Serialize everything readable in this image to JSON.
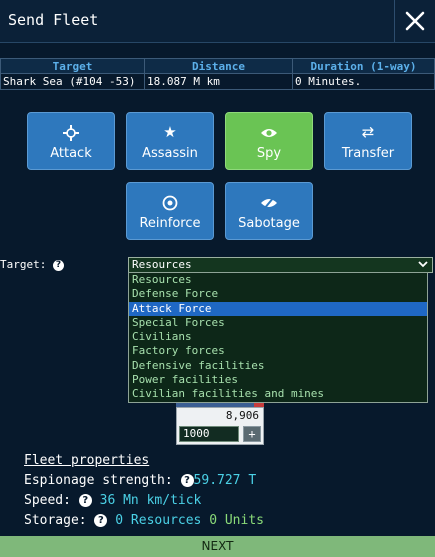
{
  "header": {
    "title": "Send Fleet",
    "close_icon": "close-icon"
  },
  "info_table": {
    "headers": [
      "Target",
      "Distance",
      "Duration (1-way)"
    ],
    "row": [
      "Shark Sea (#104 -53)",
      "18.087 M km",
      "0 Minutes."
    ]
  },
  "actions": [
    {
      "label": "Attack",
      "icon": "crosshair-icon"
    },
    {
      "label": "Assassin",
      "icon": "star-icon"
    },
    {
      "label": "Spy",
      "icon": "eye-icon",
      "selected": true
    },
    {
      "label": "Transfer",
      "icon": "swap-arrows-icon"
    },
    {
      "label": "Reinforce",
      "icon": "shield-icon"
    },
    {
      "label": "Sabotage",
      "icon": "sabotage-icon"
    }
  ],
  "target_select": {
    "label": "Target:",
    "value": "Resources",
    "options": [
      "Resources",
      "Defense Force",
      "Attack Force",
      "Special Forces",
      "Civilians",
      "Factory forces",
      "Defensive facilities",
      "Power facilities",
      "Civilian facilities and mines"
    ],
    "highlighted": "Attack Force"
  },
  "unit_panel": {
    "available": "8,906",
    "quantity": "1000",
    "plus": "+"
  },
  "fleet_properties": {
    "title": "Fleet properties",
    "espionage_label": "Espionage strength:",
    "espionage_value": "59.727 T",
    "speed_label": "Speed:",
    "speed_value": "36 Mn km/tick",
    "storage_label": "Storage:",
    "storage_resources": "0 Resources",
    "storage_units": "0 Units"
  },
  "next_label": "NEXT",
  "colors": {
    "background": "#07192c",
    "action_blue": "#2e78bd",
    "action_green": "#6ac454",
    "highlight": "#1f68c4",
    "next_bar": "#7fb87a"
  }
}
